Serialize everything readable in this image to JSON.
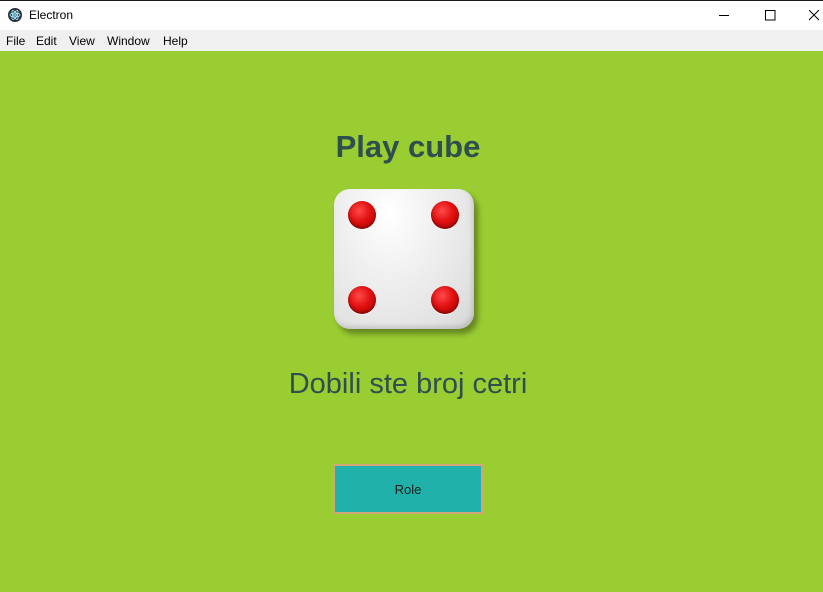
{
  "window": {
    "title": "Electron",
    "app_icon": "electron-icon",
    "controls": [
      "minimize-icon",
      "maximize-icon",
      "close-icon"
    ]
  },
  "menu": {
    "items": [
      "File",
      "Edit",
      "View",
      "Window",
      "Help"
    ]
  },
  "main": {
    "heading": "Play cube",
    "die": {
      "value": 4,
      "pip_color": "#e01010"
    },
    "result_text": "Dobili ste broj cetri",
    "button_label": "Role"
  },
  "colors": {
    "background": "#9acd32",
    "text": "#2f4f4f",
    "button": "#20b2aa",
    "button_border": "#d2a679"
  }
}
